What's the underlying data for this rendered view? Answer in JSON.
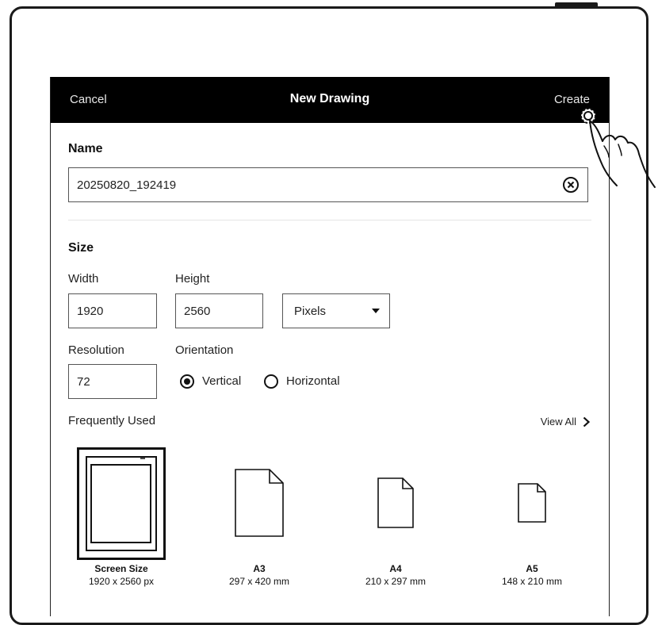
{
  "header": {
    "cancel_label": "Cancel",
    "title": "New Drawing",
    "create_label": "Create"
  },
  "name_section": {
    "title": "Name",
    "value": "20250820_192419",
    "clear_icon": "close-circle-icon"
  },
  "size_section": {
    "title": "Size",
    "width_label": "Width",
    "width_value": "1920",
    "height_label": "Height",
    "height_value": "2560",
    "unit_selected": "Pixels",
    "resolution_label": "Resolution",
    "resolution_value": "72",
    "orientation_label": "Orientation",
    "orientation_options": [
      "Vertical",
      "Horizontal"
    ],
    "orientation_selected": "Vertical"
  },
  "frequently_used": {
    "title": "Frequently Used",
    "view_all_label": "View All",
    "presets": [
      {
        "name": "Screen Size",
        "size": "1920 x 2560 px",
        "selected": true
      },
      {
        "name": "A3",
        "size": "297 x 420 mm",
        "selected": false
      },
      {
        "name": "A4",
        "size": "210 x 297 mm",
        "selected": false
      },
      {
        "name": "A5",
        "size": "148 x 210 mm",
        "selected": false
      }
    ]
  },
  "colors": {
    "header_bg": "#000000",
    "accent": "#111111"
  }
}
